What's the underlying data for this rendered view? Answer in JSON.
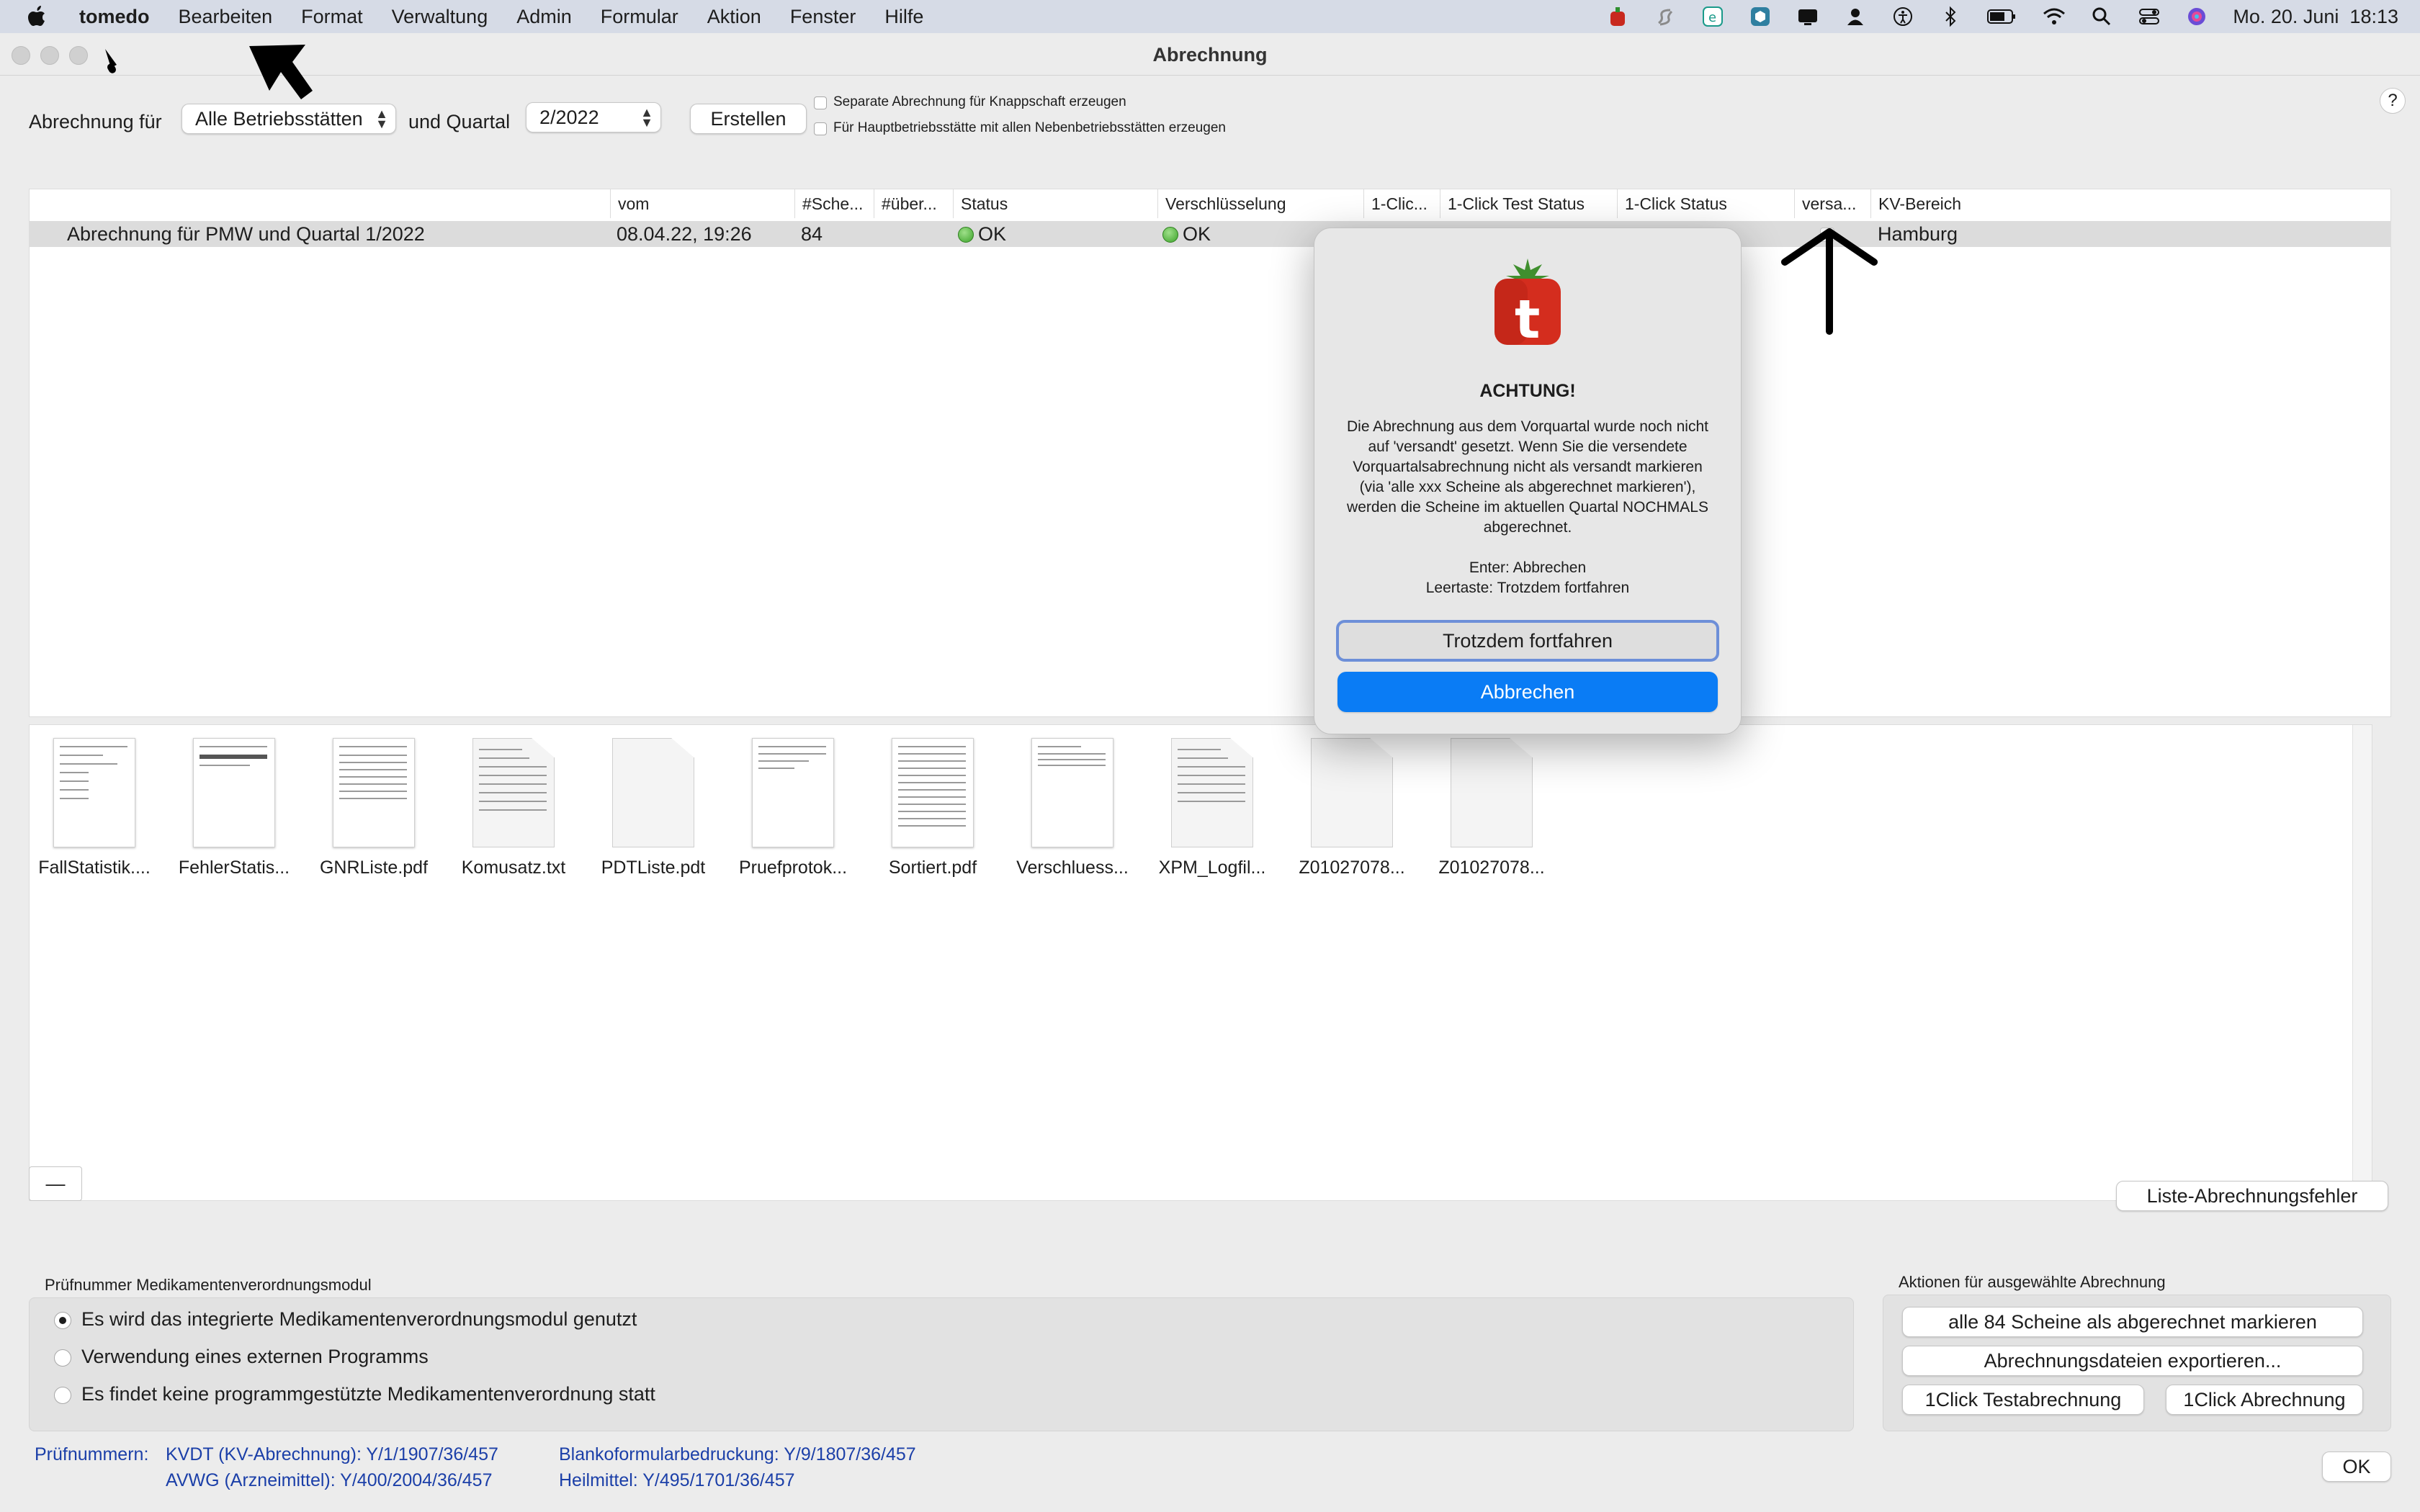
{
  "menubar": {
    "app_name": "tomedo",
    "items": [
      "Bearbeiten",
      "Format",
      "Verwaltung",
      "Admin",
      "Formular",
      "Aktion",
      "Fenster",
      "Hilfe"
    ],
    "clock": "Mo. 20. Juni  18:13"
  },
  "window": {
    "title": "Abrechnung",
    "help_label": "?"
  },
  "toolbar": {
    "abrechnung_fuer_label": "Abrechnung für",
    "betriebsstaetten_value": "Alle Betriebsstätten",
    "quartal_label": "und Quartal",
    "quartal_value": "2/2022",
    "erstellen_label": "Erstellen",
    "option_knappschaft": "Separate Abrechnung für Knappschaft erzeugen",
    "option_hauptbetrieb": "Für Hauptbetriebsstätte mit allen Nebenbetriebsstätten erzeugen"
  },
  "table": {
    "columns": [
      "vom",
      "#Sche...",
      "#über...",
      "Status",
      "Verschlüsselung",
      "1-Clic...",
      "1-Click Test Status",
      "1-Click Status",
      "versa...",
      "KV-Bereich"
    ],
    "row": {
      "name": "Abrechnung für PMW und Quartal 1/2022",
      "vom": "08.04.22, 19:26",
      "scheine": "84",
      "status": "OK",
      "verschluesselung": "OK",
      "one_click_checked": "✓",
      "kv_bereich": "Hamburg"
    }
  },
  "files": [
    "FallStatistik....",
    "FehlerStatis...",
    "GNRListe.pdf",
    "Komusatz.txt",
    "PDTListe.pdt",
    "Pruefprotok...",
    "Sortiert.pdf",
    "Verschluess...",
    "XPM_Logfil...",
    "Z01027078...",
    "Z01027078..."
  ],
  "dialog": {
    "title": "ACHTUNG!",
    "message": "Die Abrechnung aus dem Vorquartal wurde noch nicht auf 'versandt' gesetzt. Wenn Sie die versendete Vorquartalsabrechnung nicht als versandt markieren (via 'alle xxx Scheine als abgerechnet markieren'), werden die Scheine im aktuellen Quartal NOCHMALS abgerechnet.",
    "hint_enter": "Enter: Abbrechen",
    "hint_space": "Leertaste: Trotzdem fortfahren",
    "continue_label": "Trotzdem fortfahren",
    "cancel_label": "Abbrechen",
    "logo_letter": "t"
  },
  "controls": {
    "minus_label": "—",
    "liste_fehler_label": "Liste-Abrechnungsfehler"
  },
  "medication": {
    "title": "Prüfnummer Medikamentenverordnungsmodul",
    "options": [
      "Es wird das integrierte Medikamentenverordnungsmodul genutzt",
      "Verwendung eines externen Programms",
      "Es findet keine programmgestützte Medikamentenverordnung statt"
    ]
  },
  "actions": {
    "title": "Aktionen für ausgewählte Abrechnung",
    "mark_label": "alle 84 Scheine als abgerechnet markieren",
    "export_label": "Abrechnungsdateien exportieren...",
    "test_label": "1Click Testabrechnung",
    "abrechnung_label": "1Click Abrechnung"
  },
  "pruefnummern": {
    "label": "Prüfnummern:",
    "kvdt": "KVDT (KV-Abrechnung): Y/1/1907/36/457",
    "avwg": "AVWG (Arzneimittel): Y/400/2004/36/457",
    "blanko": "Blankoformularbedruckung: Y/9/1807/36/457",
    "heilmittel": "Heilmittel: Y/495/1701/36/457"
  },
  "ok_label": "OK",
  "colors": {
    "accent": "#0a7cf5",
    "status_green": "#3ca32a",
    "link_blue": "#1b3fa8"
  }
}
